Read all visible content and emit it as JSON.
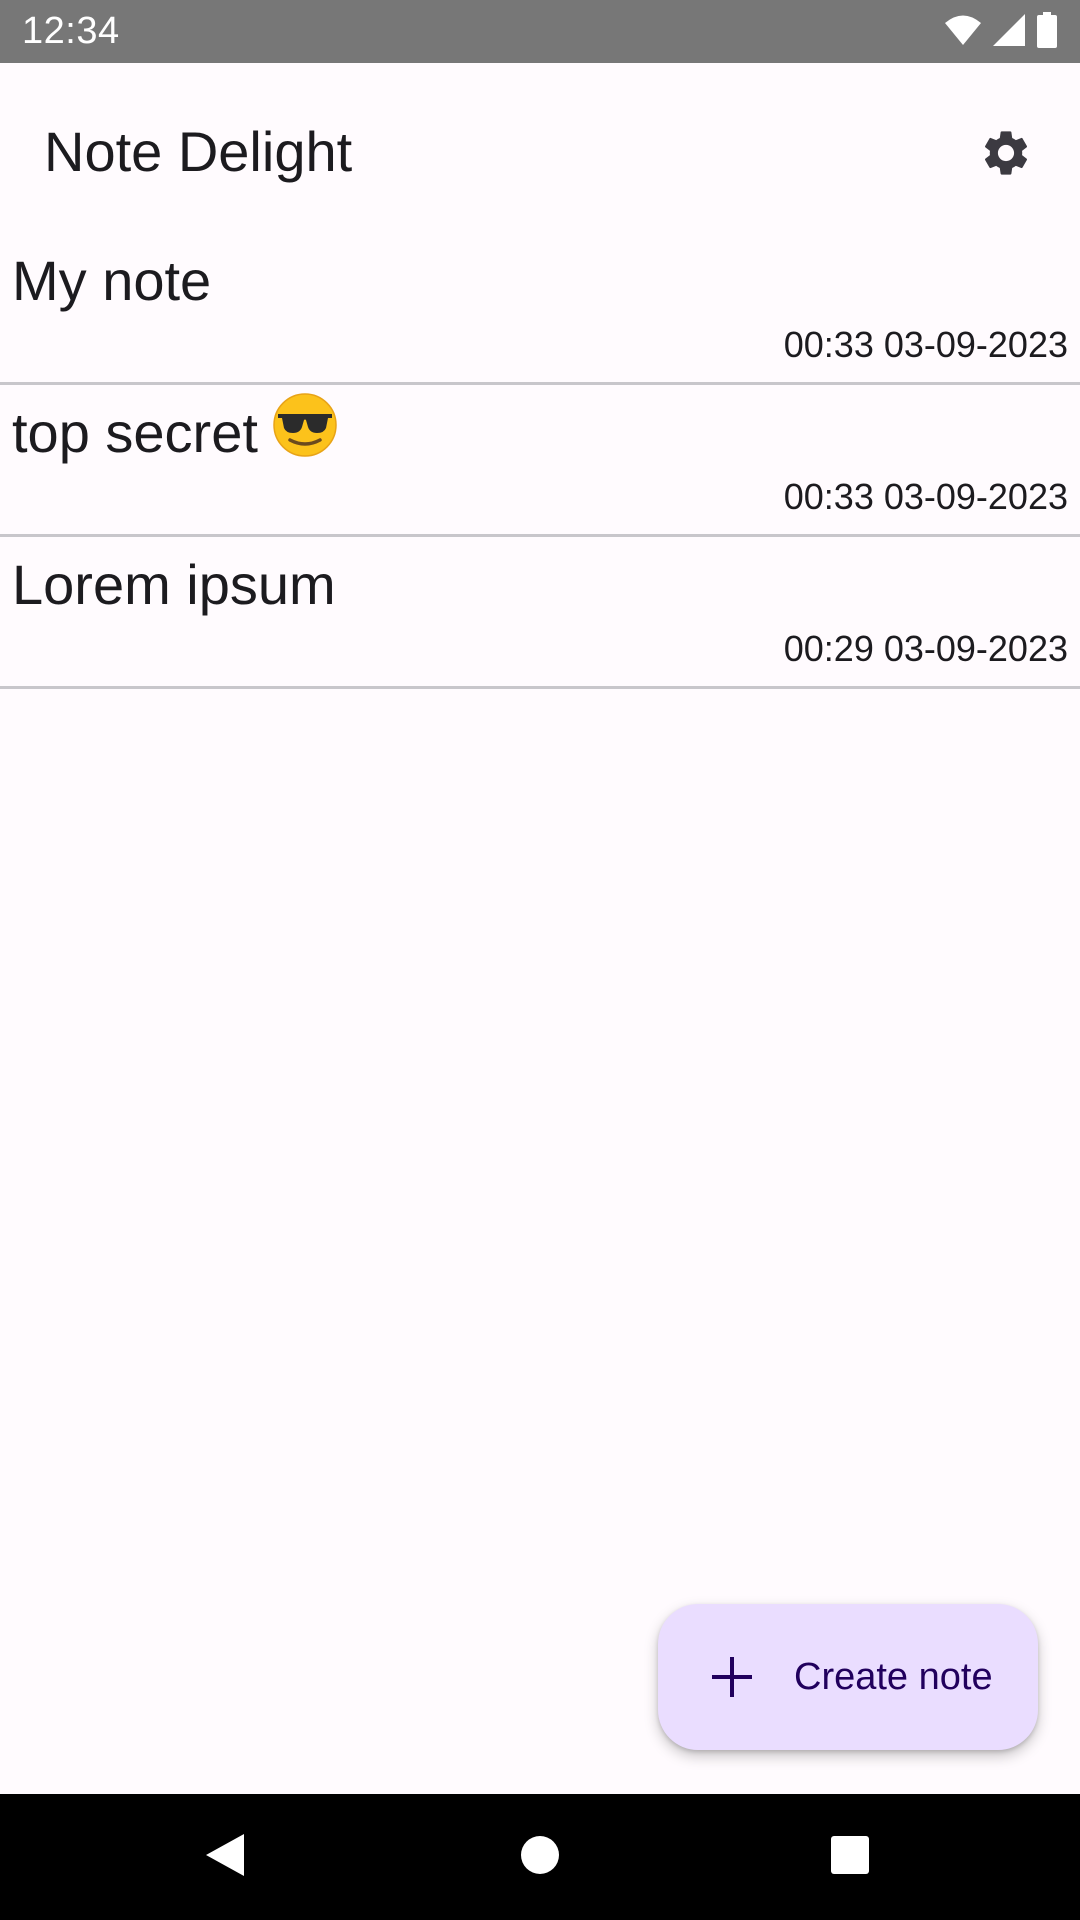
{
  "status_bar": {
    "time": "12:34",
    "icons": [
      "wifi-icon",
      "cellular-signal-icon",
      "battery-icon"
    ]
  },
  "app_bar": {
    "title": "Note Delight",
    "settings_icon": "gear-icon"
  },
  "notes": [
    {
      "title": "My note",
      "emoji": "",
      "timestamp": "00:33 03-09-2023"
    },
    {
      "title": "top secret",
      "emoji": "smiling-face-with-sunglasses",
      "timestamp": "00:33 03-09-2023"
    },
    {
      "title": "Lorem ipsum",
      "emoji": "",
      "timestamp": "00:29 03-09-2023"
    }
  ],
  "fab": {
    "label": "Create note",
    "icon": "plus-icon"
  },
  "nav_bar": {
    "buttons": [
      "back-icon",
      "home-icon",
      "recents-icon"
    ]
  },
  "colors": {
    "background": "#fffbfe",
    "status_bar": "#777777",
    "fab_container": "#eaddff",
    "fab_content": "#21005d",
    "divider": "#c8c6cb",
    "nav_bar": "#000000"
  }
}
